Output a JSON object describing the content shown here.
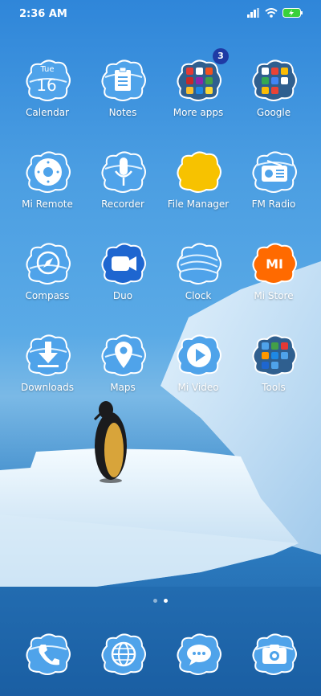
{
  "status": {
    "time": "2:36 AM"
  },
  "calendar": {
    "day": "Tue",
    "date": "16"
  },
  "apps": [
    {
      "id": "calendar",
      "label": "Calendar"
    },
    {
      "id": "notes",
      "label": "Notes"
    },
    {
      "id": "more-apps",
      "label": "More apps",
      "badge": "3"
    },
    {
      "id": "google",
      "label": "Google"
    },
    {
      "id": "mi-remote",
      "label": "Mi Remote"
    },
    {
      "id": "recorder",
      "label": "Recorder"
    },
    {
      "id": "file-manager",
      "label": "File Manager"
    },
    {
      "id": "fm-radio",
      "label": "FM Radio"
    },
    {
      "id": "compass",
      "label": "Compass"
    },
    {
      "id": "duo",
      "label": "Duo"
    },
    {
      "id": "clock",
      "label": "Clock"
    },
    {
      "id": "mi-store",
      "label": "Mi Store"
    },
    {
      "id": "downloads",
      "label": "Downloads"
    },
    {
      "id": "maps",
      "label": "Maps"
    },
    {
      "id": "mi-video",
      "label": "Mi Video"
    },
    {
      "id": "tools",
      "label": "Tools"
    }
  ],
  "mi_store_logo": "MI",
  "page_indicator": {
    "pages": 2,
    "current": 2
  },
  "dock": [
    {
      "id": "phone",
      "icon": "phone-icon"
    },
    {
      "id": "browser",
      "icon": "globe-icon"
    },
    {
      "id": "messaging",
      "icon": "chat-bubble-icon"
    },
    {
      "id": "camera",
      "icon": "camera-icon"
    }
  ],
  "colors": {
    "badge": "#1f3aa5",
    "cloud": "#4fa3ea",
    "mi_orange": "#ff6a00",
    "file_yellow": "#f7c200",
    "duo_blue": "#1e66d0"
  }
}
